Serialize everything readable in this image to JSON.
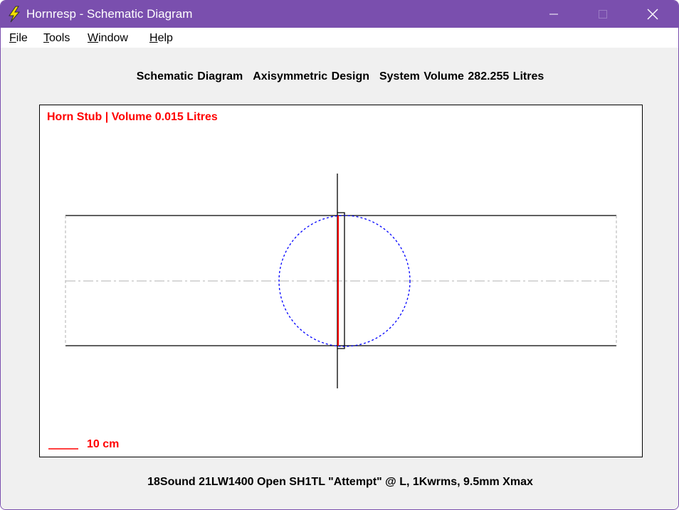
{
  "window": {
    "title": "Hornresp - Schematic Diagram",
    "app_icon": "lightning-bolt-icon",
    "controls": [
      "minimize-icon",
      "maximize-icon",
      "close-icon"
    ],
    "accent_color": "#7a4fae"
  },
  "menu": {
    "items": [
      {
        "label": "File"
      },
      {
        "label": "Tools"
      },
      {
        "label": "Window"
      },
      {
        "label": "Help"
      }
    ]
  },
  "header": {
    "title": "Schematic Diagram",
    "design": "Axisymmetric Design",
    "volume": "System Volume 282.255 Litres"
  },
  "diagram": {
    "horn_label": "Horn Stub | Volume 0.015 Litres",
    "scale_label": "10 cm",
    "label_color": "#ff0000",
    "driver_outline_color": "#0000ff"
  },
  "footer": {
    "description": "18Sound 21LW1400 Open SH1TL \"Attempt\" @ L, 1Kwrms, 9.5mm Xmax"
  }
}
